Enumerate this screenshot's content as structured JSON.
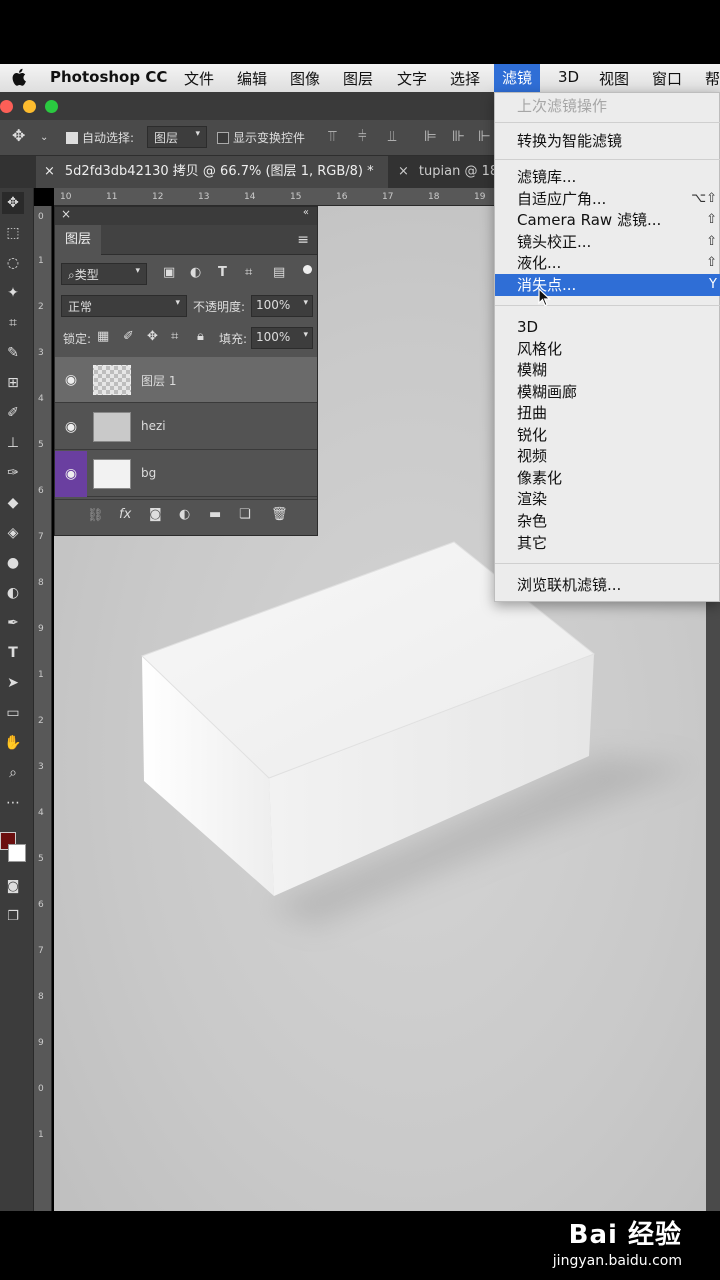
{
  "menubar": {
    "app_name": "Photoshop CC",
    "items": [
      "文件",
      "编辑",
      "图像",
      "图层",
      "文字",
      "选择",
      "滤镜",
      "3D",
      "视图",
      "窗口",
      "帮"
    ],
    "active_index": 6
  },
  "options": {
    "auto_select_label": "自动选择:",
    "auto_select_value": "图层",
    "show_transform_label": "显示变换控件"
  },
  "tabs": {
    "active": "5d2fd3db42130 拷贝 @ 66.7% (图层 1, RGB/8) *",
    "inactive": "tupian @ 18"
  },
  "ruler_top": [
    "10",
    "11",
    "12",
    "13",
    "14",
    "15",
    "16",
    "17",
    "18",
    "19"
  ],
  "ruler_left": [
    "0",
    "1",
    "2",
    "3",
    "4",
    "5",
    "6",
    "7",
    "8",
    "9",
    "1",
    "2",
    "3",
    "4",
    "5",
    "6",
    "7",
    "8",
    "9",
    "0",
    "1"
  ],
  "layers_panel": {
    "title": "图层",
    "filter_label": "类型",
    "blend_mode": "正常",
    "opacity_label": "不透明度:",
    "opacity_value": "100%",
    "lock_label": "锁定:",
    "fill_label": "填充:",
    "fill_value": "100%",
    "layers": [
      {
        "name": "图层 1",
        "selected": true
      },
      {
        "name": "hezi",
        "selected": false
      },
      {
        "name": "bg",
        "selected": false
      }
    ]
  },
  "filter_menu": {
    "items": [
      {
        "label": "上次滤镜操作",
        "disabled": true
      },
      {
        "label": "转换为智能滤镜"
      },
      {
        "label": "滤镜库..."
      },
      {
        "label": "自适应广角...",
        "shortcut": "⌥⇧"
      },
      {
        "label": "Camera Raw 滤镜...",
        "shortcut": "⇧"
      },
      {
        "label": "镜头校正...",
        "shortcut": "⇧"
      },
      {
        "label": "液化...",
        "shortcut": "⇧"
      },
      {
        "label": "消失点...",
        "shortcut": "Y",
        "highlighted": true
      },
      {
        "label": "3D"
      },
      {
        "label": "风格化"
      },
      {
        "label": "模糊"
      },
      {
        "label": "模糊画廊"
      },
      {
        "label": "扭曲"
      },
      {
        "label": "锐化"
      },
      {
        "label": "视频"
      },
      {
        "label": "像素化"
      },
      {
        "label": "渲染"
      },
      {
        "label": "杂色"
      },
      {
        "label": "其它"
      },
      {
        "label": "浏览联机滤镜..."
      }
    ]
  },
  "watermark": {
    "brand": "Bai 经验",
    "url": "jingyan.baidu.com"
  },
  "colors": {
    "accent": "#2f6ed6",
    "foreground_swatch": "#6b0f0f",
    "bg_layer_eye": "#6a3fa0"
  }
}
